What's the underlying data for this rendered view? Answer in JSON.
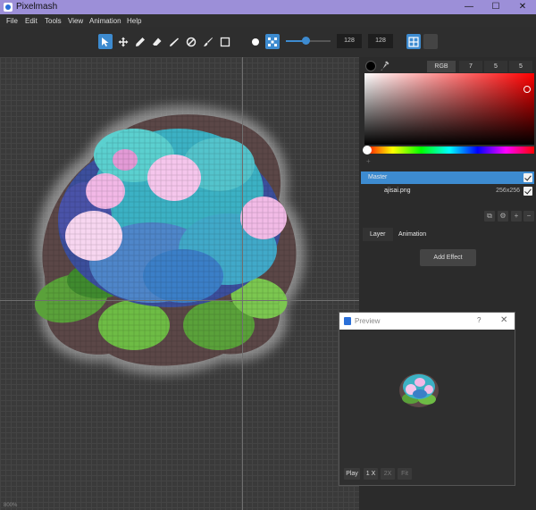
{
  "window": {
    "title": "Pixelmash",
    "minimize": "—",
    "maximize": "☐",
    "close": "✕"
  },
  "menu": [
    "File",
    "Edit",
    "Tools",
    "View",
    "Animation",
    "Help"
  ],
  "toolbar": {
    "width_value": "128",
    "height_value": "128",
    "brush_size_percent": 45
  },
  "color_panel": {
    "mode": "RGB",
    "values": [
      "7",
      "5",
      "5"
    ],
    "current_color": "#000000"
  },
  "layers": {
    "master_label": "Master",
    "items": [
      {
        "name": "ajisai.png",
        "size": "256x256"
      }
    ]
  },
  "tabs": {
    "layer": "Layer",
    "animation": "Animation"
  },
  "effects": {
    "add_label": "Add Effect"
  },
  "preview": {
    "title": "Preview",
    "help": "?",
    "close": "✕",
    "buttons": {
      "play": "Play",
      "x1": "1 X",
      "x2": "2X",
      "fit": "Fit"
    }
  },
  "canvas": {
    "zoom_readout": "800%"
  },
  "colors": {
    "accent": "#3d8bd0",
    "titlebar": "#9c8fd8"
  }
}
